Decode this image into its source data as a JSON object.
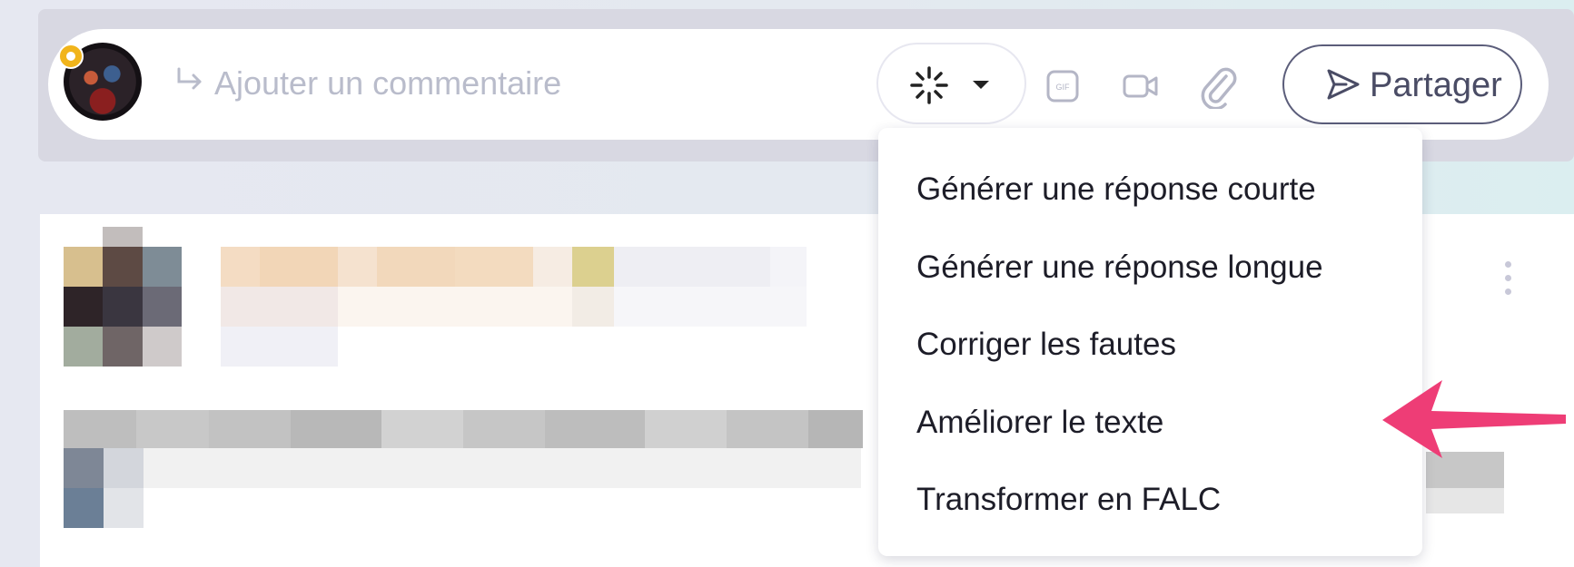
{
  "composer": {
    "placeholder": "Ajouter un commentaire",
    "share_label": "Partager",
    "icons": [
      "reply-arrow-icon",
      "ai-sparkle-icon",
      "gif-icon",
      "video-icon",
      "paperclip-icon",
      "send-icon"
    ]
  },
  "ai_menu": {
    "items": [
      {
        "label": "Générer une réponse courte"
      },
      {
        "label": "Générer une réponse longue"
      },
      {
        "label": "Corriger les fautes"
      },
      {
        "label": "Améliorer le texte"
      },
      {
        "label": "Transformer en FALC"
      }
    ]
  },
  "post": {
    "more_icon": "vertical-ellipsis-icon"
  },
  "colors": {
    "accent": "#5b5d7a",
    "placeholder": "#b9bccb",
    "annotation_arrow": "#ee3d76",
    "badge": "#f1b41b"
  }
}
